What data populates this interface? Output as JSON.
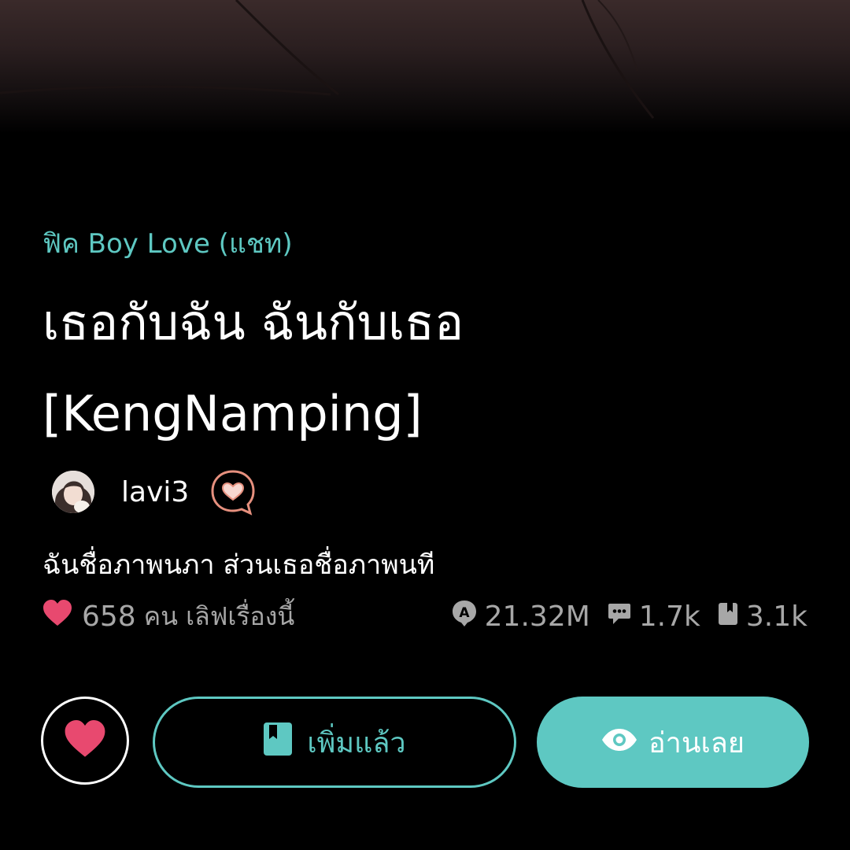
{
  "story": {
    "category": "ฟิค Boy Love (แชท)",
    "title": "เธอกับฉัน ฉันกับเธอ [KengNamping]",
    "synopsis": "ฉันชื่อภาพนภา ส่วนเธอชื่อภาพนที"
  },
  "author": {
    "name": "lavi3",
    "avatar_icon": "avatar-photo",
    "badge_icon": "heart-chat-badge-icon"
  },
  "stats": {
    "love_count": "658",
    "love_text": "คน เลิฟเรื่องนี้",
    "views": "21.32M",
    "comments": "1.7k",
    "bookmarks": "3.1k"
  },
  "actions": {
    "love_icon": "heart-icon",
    "added_label": "เพิ่มแล้ว",
    "read_label": "อ่านเลย"
  },
  "colors": {
    "accent": "#5ec8c2",
    "heart": "#e8496f",
    "muted": "#a7a7a7",
    "background": "#000000"
  }
}
